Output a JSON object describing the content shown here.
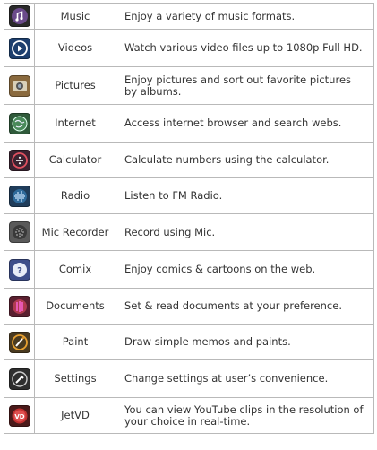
{
  "apps": [
    {
      "icon": "music-icon",
      "name": "Music",
      "description": "Enjoy a variety of music formats."
    },
    {
      "icon": "videos-icon",
      "name": "Videos",
      "description": "Watch various video files up to 1080p Full HD."
    },
    {
      "icon": "pictures-icon",
      "name": "Pictures",
      "description": "Enjoy pictures and sort out favorite pictures by albums."
    },
    {
      "icon": "internet-icon",
      "name": "Internet",
      "description": "Access internet browser and search webs."
    },
    {
      "icon": "calculator-icon",
      "name": "Calculator",
      "description": "Calculate numbers using the calculator."
    },
    {
      "icon": "radio-icon",
      "name": "Radio",
      "description": "Listen to FM Radio."
    },
    {
      "icon": "mic-recorder-icon",
      "name": "Mic Recorder",
      "description": "Record using Mic."
    },
    {
      "icon": "comix-icon",
      "name": "Comix",
      "description": "Enjoy comics & cartoons on the web."
    },
    {
      "icon": "documents-icon",
      "name": "Documents",
      "description": "Set & read documents at your preference."
    },
    {
      "icon": "paint-icon",
      "name": "Paint",
      "description": "Draw simple memos and paints."
    },
    {
      "icon": "settings-icon",
      "name": "Settings",
      "description": "Change settings at user’s convenience."
    },
    {
      "icon": "jetvd-icon",
      "name": "JetVD",
      "description": "You can view YouTube clips in the resolution of your choice in real-time.",
      "icon_text": "VD"
    }
  ]
}
